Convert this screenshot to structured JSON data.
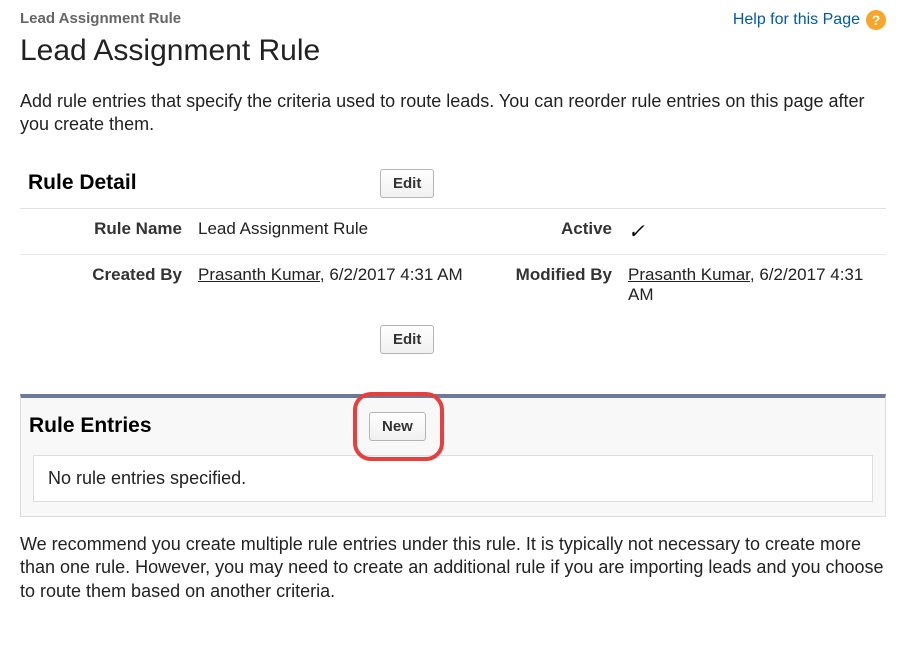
{
  "header": {
    "breadcrumb": "Lead Assignment Rule",
    "help_label": "Help for this Page",
    "help_glyph": "?"
  },
  "page_title": "Lead Assignment Rule",
  "intro_text": "Add rule entries that specify the criteria used to route leads. You can reorder rule entries on this page after you create them.",
  "rule_detail": {
    "section_title": "Rule Detail",
    "edit_label": "Edit",
    "fields": {
      "rule_name_label": "Rule Name",
      "rule_name_value": "Lead Assignment Rule",
      "active_label": "Active",
      "active_value": "✓",
      "created_by_label": "Created By",
      "created_by_user": "Prasanth Kumar",
      "created_by_datetime": ", 6/2/2017 4:31 AM",
      "modified_by_label": "Modified By",
      "modified_by_user": "Prasanth Kumar",
      "modified_by_datetime": ", 6/2/2017 4:31 AM"
    }
  },
  "rule_entries": {
    "section_title": "Rule Entries",
    "new_label": "New",
    "empty_message": "No rule entries specified."
  },
  "footer_text": "We recommend you create multiple rule entries under this rule. It is typically not necessary to create more than one rule. However, you may need to create an additional rule if you are importing leads and you choose to route them based on another criteria."
}
